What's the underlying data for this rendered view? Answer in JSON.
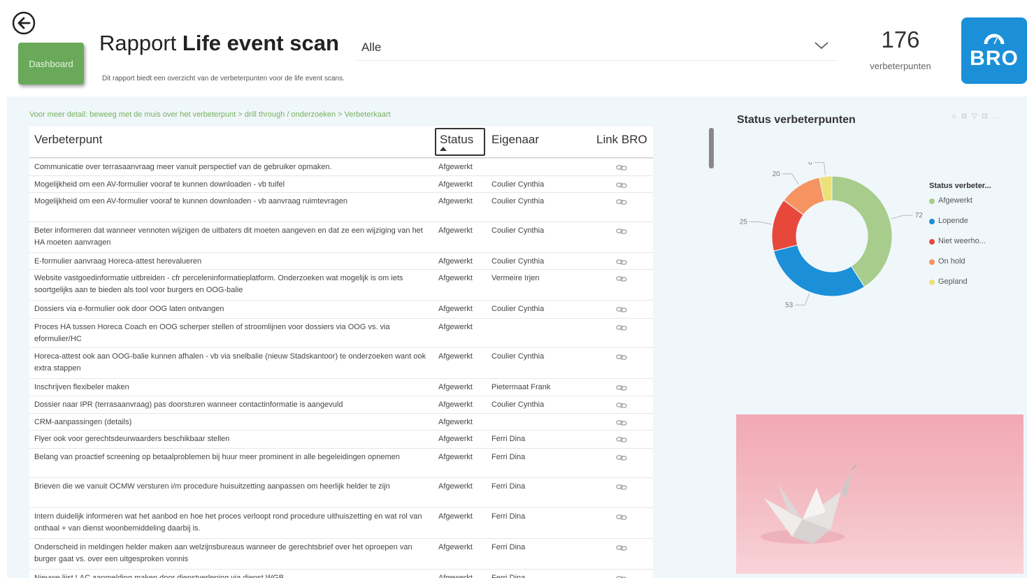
{
  "header": {
    "dashboard_button": "Dashboard",
    "title_prefix": "Rapport ",
    "title_bold": "Life event scan",
    "subtitle": "Dit rapport biedt een overzicht van de verbeterpunten voor de life event scans.",
    "filter_value": "Alle",
    "count_value": "176",
    "count_label": "verbeterpunten",
    "logo_text": "BRO"
  },
  "hint": "Voor meer detail: beweeg met de muis over het verbeterpunt > drill through / onderzoeken > Verbeterkaart",
  "table": {
    "columns": [
      "Verbeterpunt",
      "Status",
      "Eigenaar",
      "Link BRO"
    ],
    "sort_column": "Status",
    "rows": [
      {
        "text": "Communicatie over terrasaanvraag meer vanuit perspectief van de gebruiker opmaken.",
        "status": "Afgewerkt",
        "owner": ""
      },
      {
        "text": "Mogelijkheid om een AV-formulier vooraf te kunnen downloaden - vb tuifel",
        "status": "Afgewerkt",
        "owner": "Coulier Cynthia"
      },
      {
        "text": "Mogelijkheid om een AV-formulier vooraf te kunnen downloaden - vb aanvraag ruimtevragen",
        "status": "Afgewerkt",
        "owner": "Coulier Cynthia"
      },
      {
        "text": "Beter informeren dat wanneer vennoten wijzigen de uitbaters dit moeten aangeven en dat ze een wijziging van het HA moeten aanvragen",
        "status": "Afgewerkt",
        "owner": "Coulier Cynthia"
      },
      {
        "text": "E-formulier aanvraag Horeca-attest herevalueren",
        "status": "Afgewerkt",
        "owner": "Coulier Cynthia"
      },
      {
        "text": "Website vastgoedinformatie uitbreiden - cfr percelen­informatieplatform. Onderzoeken wat mogelijk is om iets soortgelijks aan te bieden als tool voor burgers en OOG-balie",
        "status": "Afgewerkt",
        "owner": "Vermeire Irjen"
      },
      {
        "text": "Dossiers via e-formulier ook door OOG laten ontvangen",
        "status": "Afgewerkt",
        "owner": "Coulier Cynthia"
      },
      {
        "text": "Proces HA tussen Horeca Coach en OOG scherper stellen of stroomlijnen voor dossiers via OOG vs. via eformulier/HC",
        "status": "Afgewerkt",
        "owner": ""
      },
      {
        "text": "Horeca-attest ook aan OOG-balie kunnen afhalen - vb via snelbalie (nieuw Stadskantoor) te onderzoeken want ook extra stappen",
        "status": "Afgewerkt",
        "owner": "Coulier Cynthia"
      },
      {
        "text": "Inschrijven flexibeler maken",
        "status": "Afgewerkt",
        "owner": "Pietermaat Frank"
      },
      {
        "text": "Dossier naar IPR (terrasaanvraag) pas doorsturen wanneer contactinformatie is aangevuld",
        "status": "Afgewerkt",
        "owner": "Coulier Cynthia"
      },
      {
        "text": "CRM-aanpassingen (details)",
        "status": "Afgewerkt",
        "owner": ""
      },
      {
        "text": "Flyer ook voor gerechtsdeurwaarders beschikbaar stellen",
        "status": "Afgewerkt",
        "owner": "Ferri Dina"
      },
      {
        "text": "Belang van proactief screening op betaalproblemen bij huur meer prominent in alle begeleidingen opnemen",
        "status": "Afgewerkt",
        "owner": "Ferri Dina"
      },
      {
        "text": "Brieven die we vanuit OCMW versturen i/m procedure huisuitzetting aanpassen om heerlijk helder te zijn",
        "status": "Afgewerkt",
        "owner": "Ferri Dina"
      },
      {
        "text": "Intern duidelijk informeren wat het aanbod en hoe het proces verloopt rond procedure uithuiszetting en wat rol van onthaal + van dienst woonbemiddeling daarbij is.",
        "status": "Afgewerkt",
        "owner": "Ferri Dina"
      },
      {
        "text": "Onderscheid in meldingen helder maken aan welzijnsbureaus wanneer de gerechtsbrief over het oproepen van burger gaat vs. over een uitgesproken vonnis",
        "status": "Afgewerkt",
        "owner": "Ferri Dina"
      },
      {
        "text": "Nieuwe lijst LAC aanmelding maken door dienstverlening via dienst WGB",
        "status": "Afgewerkt",
        "owner": "Ferri Dina"
      }
    ]
  },
  "chart": {
    "title": "Status verbeterpunten",
    "tools": "⌂ ⊟ ▽ ⊡ …",
    "legend_title": "Status verbeter...",
    "colors": {
      "Afgewerkt": "#a8cc8c",
      "Lopende": "#1b8fd8",
      "Niet weerhouden": "#e8483c",
      "On hold": "#f59460",
      "Gepland": "#ebe178"
    }
  },
  "chart_data": {
    "type": "pie",
    "title": "Status verbeterpunten",
    "legend_title": "Status verbeter...",
    "categories": [
      "Afgewerkt",
      "Lopende",
      "Niet weerho...",
      "On hold",
      "Gepland"
    ],
    "values": [
      72,
      53,
      25,
      20,
      6
    ]
  }
}
